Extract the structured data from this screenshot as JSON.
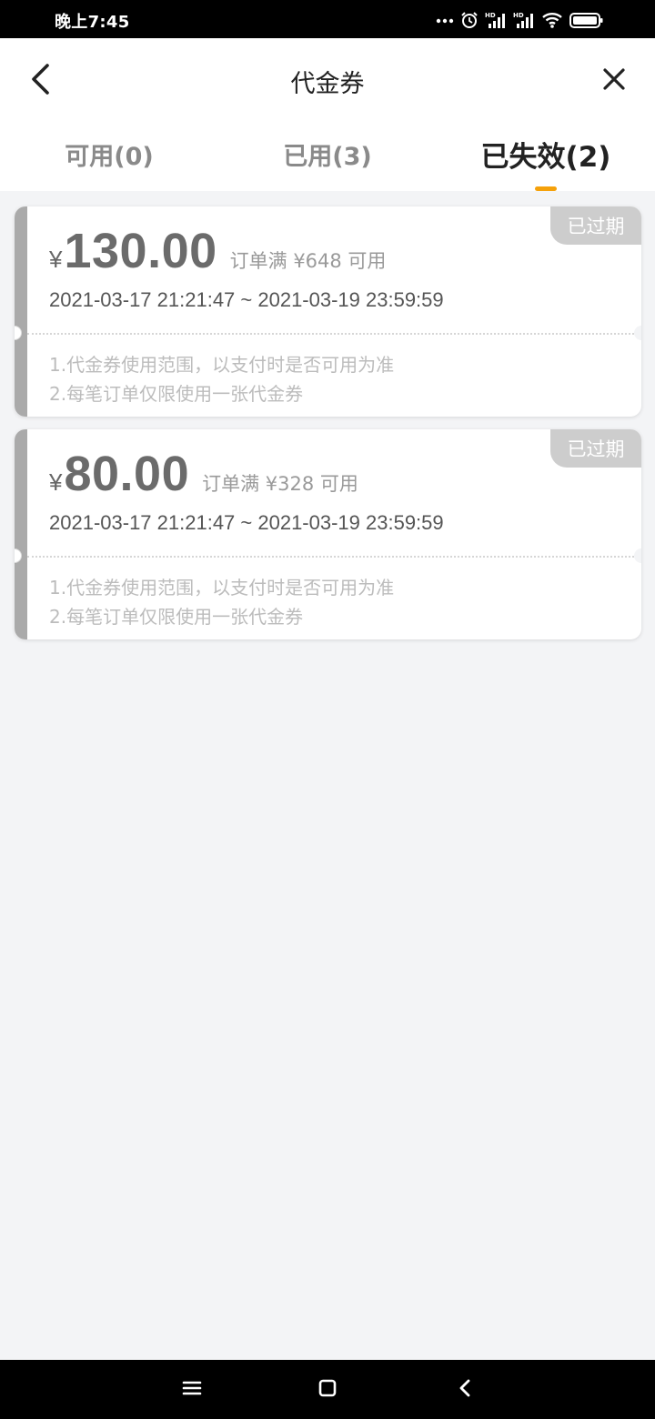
{
  "status_bar": {
    "time": "晚上7:45",
    "icons": [
      "more-dots-icon",
      "alarm-icon",
      "signal-hd-icon",
      "signal-hd-icon",
      "wifi-icon",
      "battery-icon"
    ]
  },
  "header": {
    "title": "代金券",
    "back_icon": "back-arrow-icon",
    "close_icon": "close-icon"
  },
  "tabs": [
    {
      "label": "可用(0)",
      "active": false
    },
    {
      "label": "已用(3)",
      "active": false
    },
    {
      "label": "已失效(2)",
      "active": true
    }
  ],
  "coupons": [
    {
      "badge": "已过期",
      "currency": "¥",
      "amount": "130.00",
      "condition": "订单满 ¥648 可用",
      "period": "2021-03-17 21:21:47 ~ 2021-03-19 23:59:59",
      "rule1": "1.代金券使用范围，以支付时是否可用为准",
      "rule2": "2.每笔订单仅限使用一张代金券"
    },
    {
      "badge": "已过期",
      "currency": "¥",
      "amount": "80.00",
      "condition": "订单满 ¥328 可用",
      "period": "2021-03-17 21:21:47 ~ 2021-03-19 23:59:59",
      "rule1": "1.代金券使用范围，以支付时是否可用为准",
      "rule2": "2.每笔订单仅限使用一张代金券"
    }
  ],
  "colors": {
    "accent": "#f5a10a",
    "expired_strip": "#aaaaaa",
    "badge_bg": "#cdcdcd"
  },
  "nav_bar": {
    "icons": [
      "menu-icon",
      "home-square-icon",
      "back-chevron-icon"
    ]
  }
}
